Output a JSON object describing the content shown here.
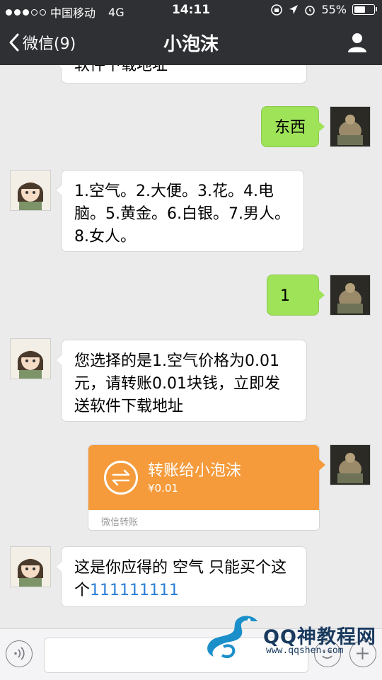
{
  "status_bar": {
    "carrier": "中国移动",
    "network": "4G",
    "time": "14:11",
    "battery": "55%"
  },
  "nav": {
    "back_label": "微信(9)",
    "title": "小泡沫"
  },
  "messages": [
    {
      "side": "in",
      "text": "软件下载地址"
    },
    {
      "side": "out",
      "text": "东西"
    },
    {
      "side": "in",
      "text": "1.空气。2.大便。3.花。4.电脑。5.黄金。6.白银。7.男人。8.女人。"
    },
    {
      "side": "out",
      "text": "1"
    },
    {
      "side": "in",
      "text": "您选择的是1.空气价格为0.01元，请转账0.01块钱，立即发送软件下载地址"
    },
    {
      "side": "out",
      "type": "transfer",
      "title": "转账给小泡沫",
      "amount": "¥0.01",
      "footer": "微信转账"
    },
    {
      "side": "in",
      "text_prefix": "这是你应得的 空气 只能买个这个",
      "link_text": "111111111"
    }
  ],
  "watermark": {
    "name": "QQ神教程网",
    "url": "www.qqshen.com"
  },
  "colors": {
    "nav_bg": "#2f3034",
    "chat_bg": "#ebebeb",
    "out_bubble": "#9fe358",
    "transfer_card": "#f59b3b",
    "link": "#2a7ed8"
  }
}
